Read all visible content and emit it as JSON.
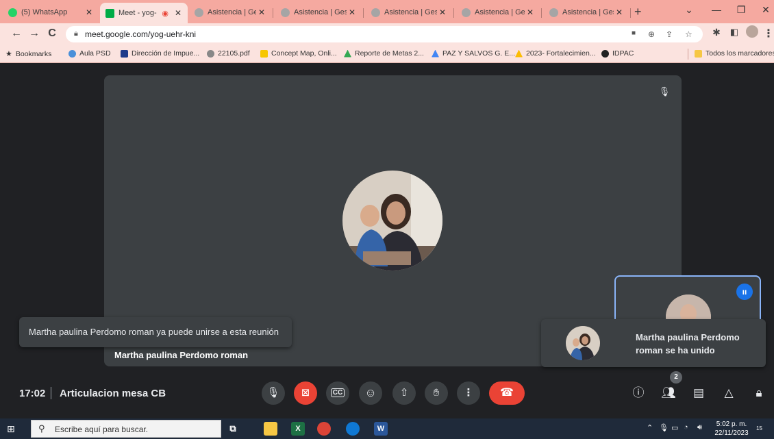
{
  "browser": {
    "tabs": [
      {
        "title": "(5) WhatsApp",
        "icon": "whatsapp-icon",
        "color": "#25d366",
        "active": false
      },
      {
        "title": "Meet - yog-",
        "icon": "meet-icon",
        "color": "#00ac47",
        "active": true
      },
      {
        "title": "Asistencia | Gest",
        "icon": "globe-icon",
        "color": "#a5a5a5",
        "active": false
      },
      {
        "title": "Asistencia | Gest",
        "icon": "globe-icon",
        "color": "#a5a5a5",
        "active": false
      },
      {
        "title": "Asistencia | Gest",
        "icon": "globe-icon",
        "color": "#a5a5a5",
        "active": false
      },
      {
        "title": "Asistencia | Gest",
        "icon": "globe-icon",
        "color": "#a5a5a5",
        "active": false
      },
      {
        "title": "Asistencia | Gest",
        "icon": "globe-icon",
        "color": "#a5a5a5",
        "active": false
      }
    ],
    "new_tab": "+",
    "url": "meet.google.com/yog-uehr-kni",
    "bookmarks": [
      {
        "label": "Bookmarks",
        "icon": "star-icon",
        "color": "#333333"
      },
      {
        "label": "Aula PSD",
        "icon": "globe-icon",
        "color": "#4a90d9"
      },
      {
        "label": "Dirección de Impue...",
        "icon": "doc-icon",
        "color": "#1e3a8a"
      },
      {
        "label": "22105.pdf",
        "icon": "pdf-icon",
        "color": "#888888"
      },
      {
        "label": "Concept Map, Onli...",
        "icon": "miro-icon",
        "color": "#f7c600"
      },
      {
        "label": "Reporte de Metas 2...",
        "icon": "drive-icon",
        "color": "#34a853"
      },
      {
        "label": "PAZ Y SALVOS G. E...",
        "icon": "drive-icon",
        "color": "#4285f4"
      },
      {
        "label": "2023- Fortalecimien...",
        "icon": "drive-icon",
        "color": "#fbbc04"
      },
      {
        "label": "IDPAC",
        "icon": "globe-icon",
        "color": "#222222"
      }
    ],
    "all_bookmarks": "Todos los marcadores"
  },
  "meet": {
    "notification_left": "Martha paulina Perdomo roman ya puede unirse a esta reunión",
    "speaker_name": "Martha paulina Perdomo roman",
    "notification_right": "Martha paulina Perdomo roman se ha unido",
    "time": "17:02",
    "meeting_title": "Articulacion mesa CB",
    "people_count": "2",
    "accent": "#1a73e8",
    "danger": "#ea4335"
  },
  "taskbar": {
    "search_placeholder": "Escribe aquí para buscar.",
    "time": "5:02 p. m.",
    "date": "22/11/2023",
    "notifications": "15"
  }
}
